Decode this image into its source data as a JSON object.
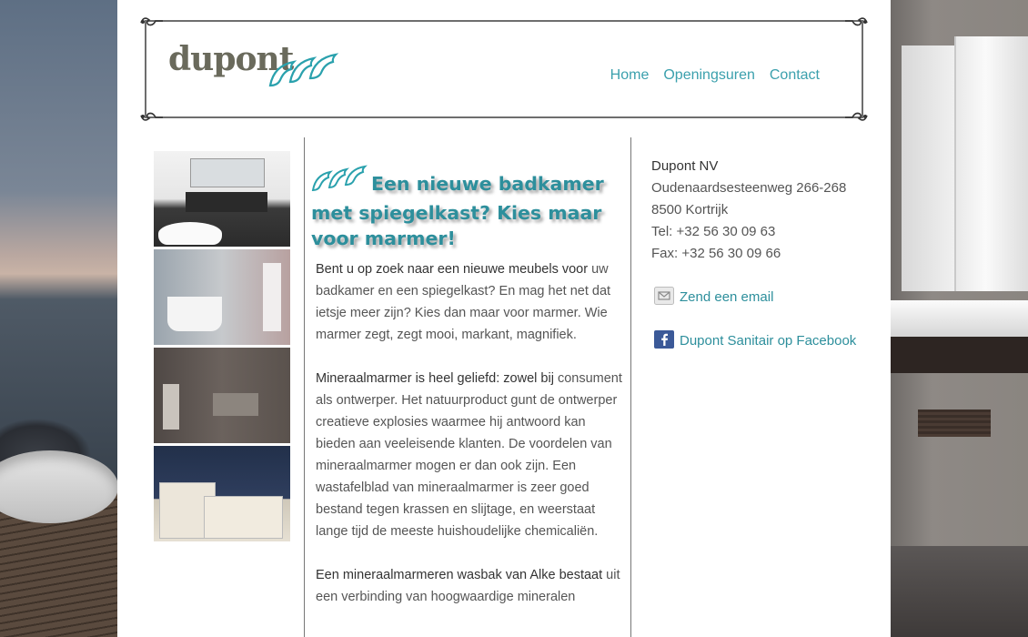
{
  "brand": {
    "name": "dupont"
  },
  "nav": {
    "items": [
      "Home",
      "Openingsuren",
      "Contact"
    ]
  },
  "article": {
    "title": "Een nieuwe badkamer met spiegelkast? Kies maar voor marmer!",
    "paragraphs": [
      {
        "lead": "Bent u op zoek naar een nieuwe meubels voor",
        "rest": " uw badkamer en een spiegelkast? En mag het net dat ietsje meer zijn? Kies dan maar voor marmer. Wie marmer zegt, zegt mooi, markant, magnifiek."
      },
      {
        "lead": "Mineraalmarmer is heel geliefd: zowel bij",
        "rest": " consument als ontwerper. Het natuurproduct gunt de ontwerper creatieve explosies waarmee hij antwoord kan bieden aan veeleisende klanten. De voordelen van mineraalmarmer mogen er dan ook zijn. Een wastafelblad van mineraalmarmer is zeer goed bestand tegen krassen en slijtage, en weerstaat lange tijd de meeste huishoudelijke chemicaliën."
      },
      {
        "lead": "Een mineraalmarmeren wasbak van Alke bestaat",
        "rest": " uit een verbinding van hoogwaardige mineralen"
      }
    ]
  },
  "company": {
    "name": "Dupont NV",
    "street": "Oudenaardsesteenweg 266-268",
    "city": "8500 Kortrijk",
    "tel": "Tel: +32 56 30 09 63",
    "fax": "Fax: +32 56 30 09 66",
    "email_link": "Zend een email",
    "facebook_link": "Dupont Sanitair op Facebook"
  },
  "colors": {
    "accent": "#2d8f9c",
    "text": "#555555",
    "logo": "#6a6a5c"
  }
}
